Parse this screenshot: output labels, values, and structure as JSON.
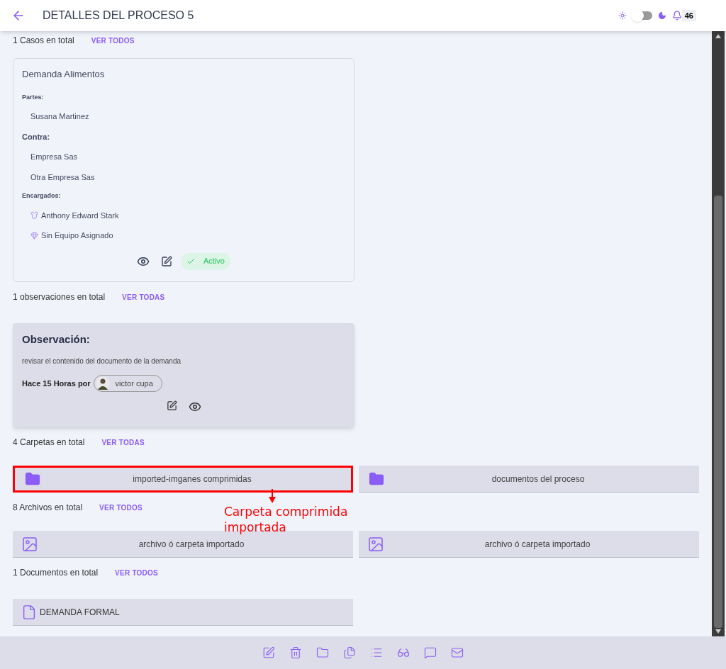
{
  "header": {
    "title": "DETALLES DEL PROCESO 5",
    "dark_mode": false,
    "notifications": "46"
  },
  "cases": {
    "summary": "1 Casos en total",
    "link": "VER TODOS",
    "card": {
      "title": "Demanda Alimentos",
      "partes_label": "Partes:",
      "partes": [
        "Susana Martinez"
      ],
      "contra_label": "Contra:",
      "contra": [
        "Empresa Sas",
        "Otra Empresa Sas"
      ],
      "encargados_label": "Encargados:",
      "encargados": [
        {
          "kind": "person",
          "name": "Anthony Edward Stark"
        },
        {
          "kind": "team",
          "name": "Sin Equipo Asignado"
        }
      ],
      "status": {
        "label": "Activo",
        "active": true
      }
    }
  },
  "observations": {
    "summary": "1 observaciones en total",
    "link": "VER TODAS",
    "card": {
      "title": "Observación:",
      "text": "revisar el contenido del documento de la demanda",
      "meta": "Hace 15 Horas por",
      "author": "victor cupa"
    }
  },
  "folders": {
    "summary": "4 Carpetas en total",
    "link": "VER TODAS",
    "items": [
      {
        "name": "imported-imganes comprimidas",
        "highlighted": true
      },
      {
        "name": "documentos del proceso",
        "highlighted": false
      }
    ]
  },
  "annotation": {
    "text": "Carpeta comprimida importada"
  },
  "files": {
    "summary": "8 Archivos en total",
    "link": "VER TODOS",
    "items": [
      {
        "name": "archivo ó carpeta importado"
      },
      {
        "name": "archivo ó carpeta importado"
      }
    ]
  },
  "documents": {
    "summary": "1 Documentos en total",
    "link": "VER TODOS",
    "items": [
      {
        "name": "DEMANDA FORMAL"
      }
    ]
  },
  "toolbar": [
    {
      "kind": "edit"
    },
    {
      "kind": "delete"
    },
    {
      "kind": "folder"
    },
    {
      "kind": "files"
    },
    {
      "kind": "list"
    },
    {
      "kind": "glasses"
    },
    {
      "kind": "comment"
    },
    {
      "kind": "mail"
    }
  ]
}
